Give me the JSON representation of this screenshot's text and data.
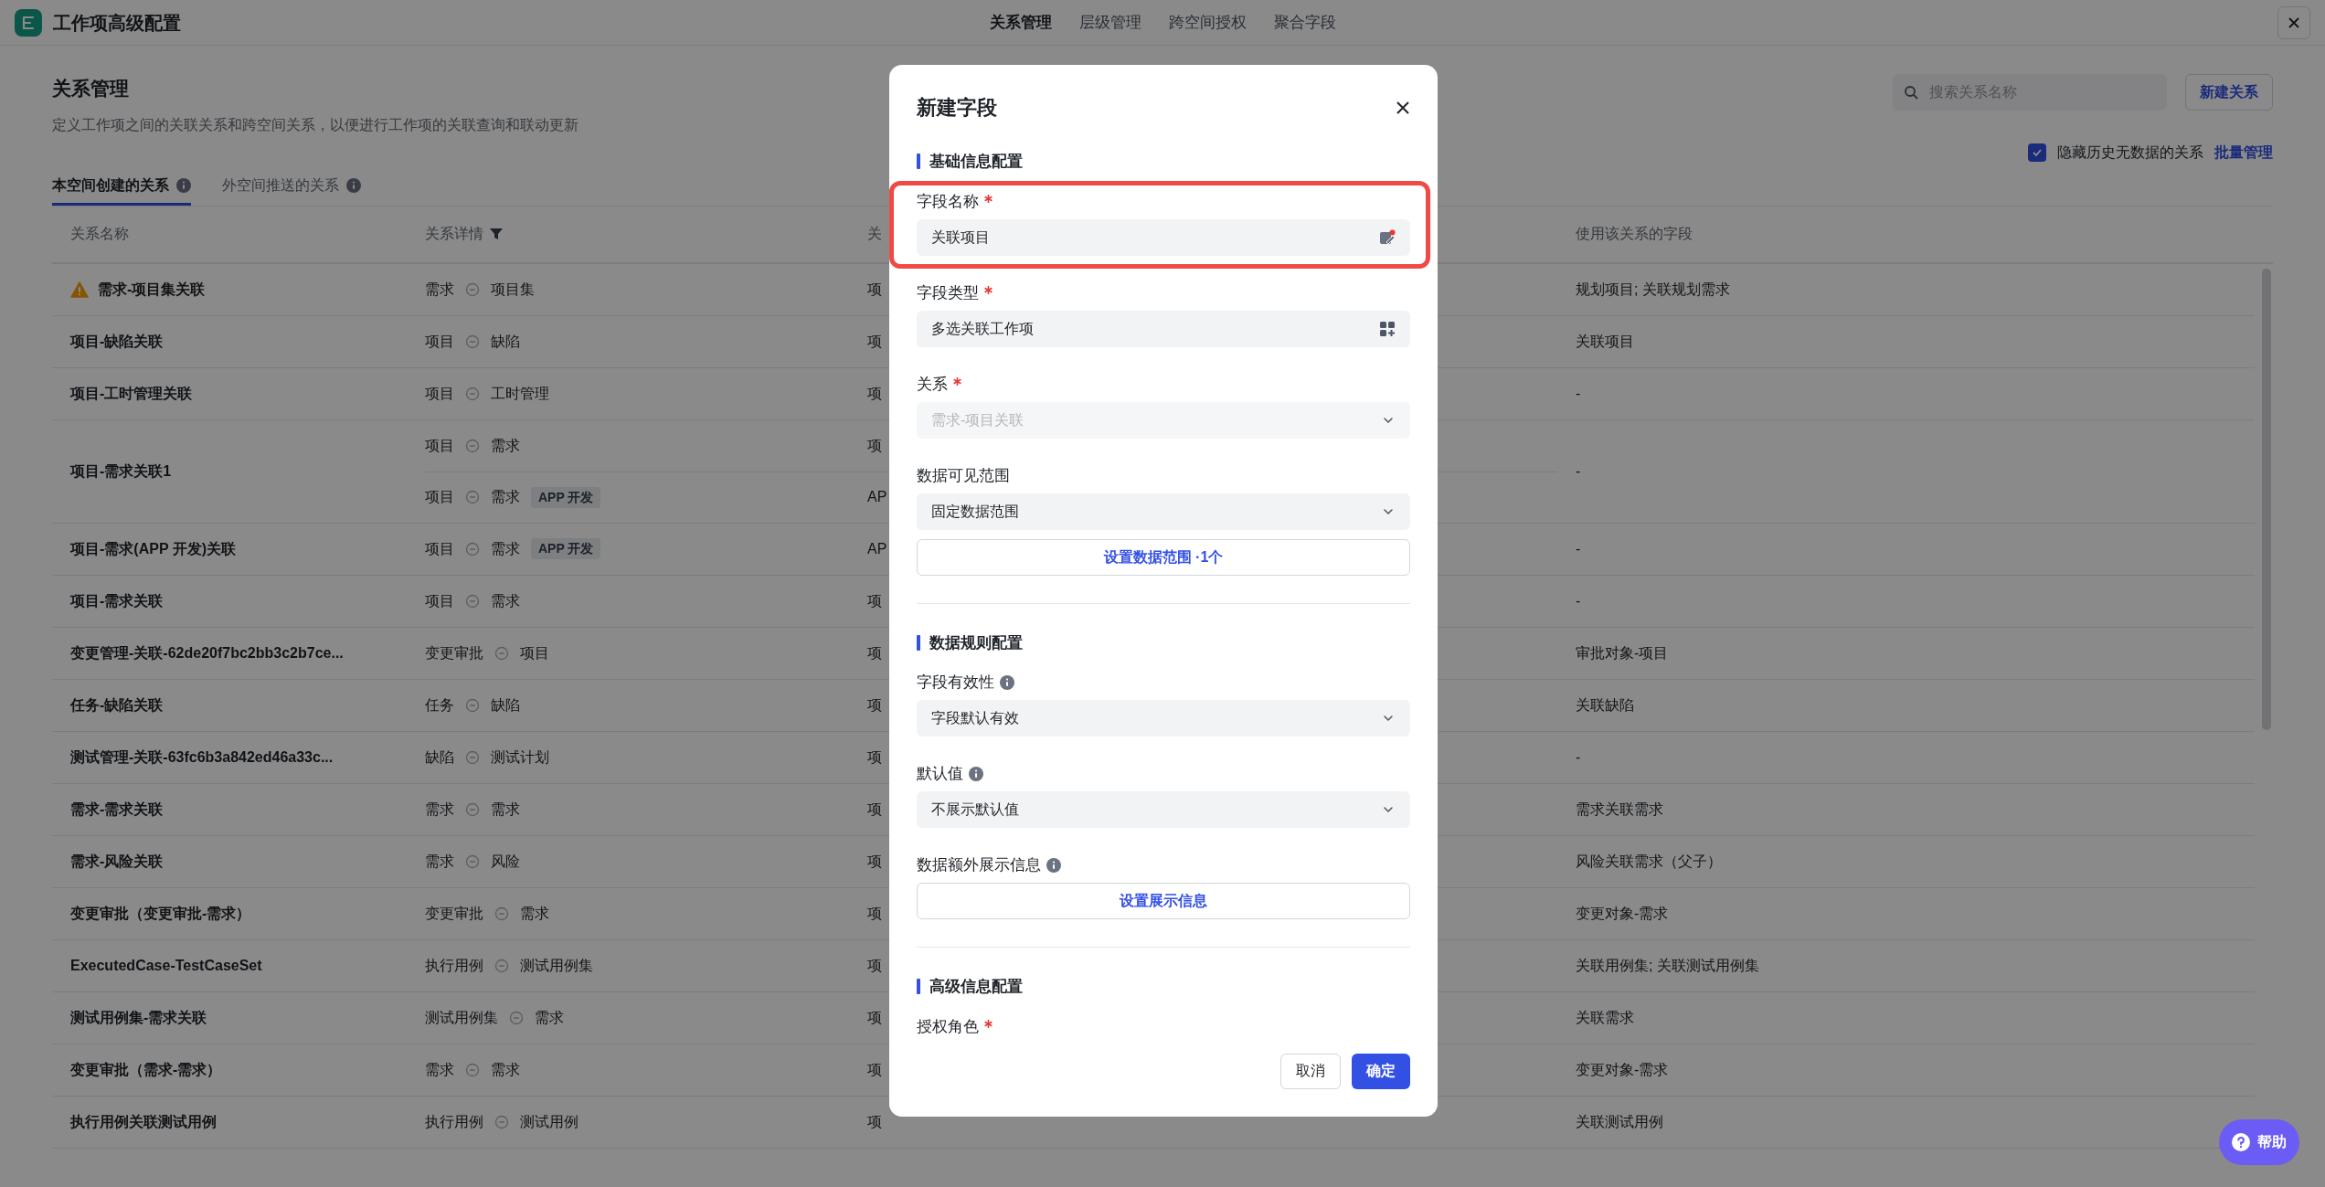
{
  "app": {
    "title": "工作项高级配置"
  },
  "nav": [
    {
      "label": "关系管理",
      "selected": true
    },
    {
      "label": "层级管理",
      "selected": false
    },
    {
      "label": "跨空间授权",
      "selected": false
    },
    {
      "label": "聚合字段",
      "selected": false
    }
  ],
  "page": {
    "title": "关系管理",
    "description": "定义工作项之间的关联关系和跨空间关系，以便进行工作项的关联查询和联动更新",
    "search": {
      "placeholder": "搜索关系名称"
    },
    "new_button": "新建关系",
    "hide_empty": {
      "label": "隐藏历史无数据的关系",
      "checked": true
    },
    "batch_link": "批量管理"
  },
  "tabs": [
    {
      "label": "本空间创建的关系",
      "selected": true
    },
    {
      "label": "外空间推送的关系",
      "selected": false
    }
  ],
  "table": {
    "columns": [
      "关系名称",
      "关系详情",
      "关",
      "使用该关系的字段"
    ],
    "rows": [
      {
        "name": "需求-项目集关联",
        "warning": true,
        "details": [
          {
            "from": "需求",
            "to": "项目集",
            "column_3": "项"
          }
        ],
        "fields": "规划项目; 关联规划需求"
      },
      {
        "name": "项目-缺陷关联",
        "warning": false,
        "details": [
          {
            "from": "项目",
            "to": "缺陷",
            "column_3": "项"
          }
        ],
        "fields": "关联项目"
      },
      {
        "name": "项目-工时管理关联",
        "warning": false,
        "details": [
          {
            "from": "项目",
            "to": "工时管理",
            "column_3": "项"
          }
        ],
        "fields": "-"
      },
      {
        "name": "项目-需求关联1",
        "warning": false,
        "details": [
          {
            "from": "项目",
            "to": "需求",
            "column_3": "项"
          },
          {
            "from": "项目",
            "to": "需求",
            "tag": "APP 开发",
            "column_3": "AP"
          }
        ],
        "fields": "-"
      },
      {
        "name": "项目-需求(APP 开发)关联",
        "warning": false,
        "details": [
          {
            "from": "项目",
            "to": "需求",
            "tag": "APP 开发",
            "column_3": "AP"
          }
        ],
        "fields": "-"
      },
      {
        "name": "项目-需求关联",
        "warning": false,
        "details": [
          {
            "from": "项目",
            "to": "需求",
            "column_3": "项"
          }
        ],
        "fields": "-"
      },
      {
        "name": "变更管理-关联-62de20f7bc2bb3c2b7ce...",
        "warning": false,
        "details": [
          {
            "from": "变更审批",
            "to": "项目",
            "column_3": "项"
          }
        ],
        "fields": "审批对象-项目"
      },
      {
        "name": "任务-缺陷关联",
        "warning": false,
        "details": [
          {
            "from": "任务",
            "to": "缺陷",
            "column_3": "项"
          }
        ],
        "fields": "关联缺陷"
      },
      {
        "name": "测试管理-关联-63fc6b3a842ed46a33c...",
        "warning": false,
        "details": [
          {
            "from": "缺陷",
            "to": "测试计划",
            "column_3": "项"
          }
        ],
        "fields": "-"
      },
      {
        "name": "需求-需求关联",
        "warning": false,
        "details": [
          {
            "from": "需求",
            "to": "需求",
            "column_3": "项"
          }
        ],
        "fields": "需求关联需求"
      },
      {
        "name": "需求-风险关联",
        "warning": false,
        "details": [
          {
            "from": "需求",
            "to": "风险",
            "column_3": "项"
          }
        ],
        "fields": "风险关联需求（父子）"
      },
      {
        "name": "变更审批（变更审批-需求）",
        "warning": false,
        "details": [
          {
            "from": "变更审批",
            "to": "需求",
            "column_3": "项"
          }
        ],
        "fields": "变更对象-需求"
      },
      {
        "name": "ExecutedCase-TestCaseSet",
        "warning": false,
        "details": [
          {
            "from": "执行用例",
            "to": "测试用例集",
            "column_3": "项"
          }
        ],
        "fields": "关联用例集; 关联测试用例集"
      },
      {
        "name": "测试用例集-需求关联",
        "warning": false,
        "details": [
          {
            "from": "测试用例集",
            "to": "需求",
            "column_3": "项"
          }
        ],
        "fields": "关联需求"
      },
      {
        "name": "变更审批（需求-需求）",
        "warning": false,
        "details": [
          {
            "from": "需求",
            "to": "需求",
            "column_3": "项"
          }
        ],
        "fields": "变更对象-需求"
      },
      {
        "name": "执行用例关联测试用例",
        "warning": false,
        "details": [
          {
            "from": "执行用例",
            "to": "测试用例",
            "column_3": "项"
          }
        ],
        "fields": "关联测试用例"
      }
    ]
  },
  "dialog": {
    "title": "新建字段",
    "items": [
      {
        "kind": "section",
        "label": "基础信息配置"
      },
      {
        "kind": "field",
        "label": "字段名称",
        "required": true,
        "info": false,
        "highlighted": true,
        "controls": [
          {
            "kind": "text",
            "value": "关联项目",
            "disabled": false
          }
        ]
      },
      {
        "kind": "field",
        "label": "字段类型",
        "required": true,
        "info": false,
        "highlighted": false,
        "controls": [
          {
            "kind": "type-picker",
            "value": "多选关联工作项",
            "disabled": false
          }
        ]
      },
      {
        "kind": "field",
        "label": "关系",
        "required": true,
        "info": false,
        "highlighted": false,
        "controls": [
          {
            "kind": "select",
            "value": "需求-项目关联",
            "disabled": true
          }
        ]
      },
      {
        "kind": "field",
        "label": "数据可见范围",
        "required": false,
        "info": false,
        "highlighted": false,
        "controls": [
          {
            "kind": "select",
            "value": "固定数据范围",
            "disabled": false
          },
          {
            "kind": "button",
            "value": "设置数据范围 ·1个",
            "disabled": false
          }
        ]
      },
      {
        "kind": "divider"
      },
      {
        "kind": "section",
        "label": "数据规则配置"
      },
      {
        "kind": "field",
        "label": "字段有效性",
        "required": false,
        "info": true,
        "highlighted": false,
        "controls": [
          {
            "kind": "select",
            "value": "字段默认有效",
            "disabled": false
          }
        ]
      },
      {
        "kind": "field",
        "label": "默认值",
        "required": false,
        "info": true,
        "highlighted": false,
        "controls": [
          {
            "kind": "select",
            "value": "不展示默认值",
            "disabled": false
          }
        ]
      },
      {
        "kind": "field",
        "label": "数据额外展示信息",
        "required": false,
        "info": true,
        "highlighted": false,
        "controls": [
          {
            "kind": "button",
            "value": "设置展示信息",
            "disabled": false
          }
        ]
      },
      {
        "kind": "divider"
      },
      {
        "kind": "section",
        "label": "高级信息配置"
      },
      {
        "kind": "field",
        "label": "授权角色",
        "required": true,
        "info": false,
        "highlighted": false
      }
    ],
    "cancel": "取消",
    "confirm": "确定"
  },
  "help": {
    "label": "帮助"
  }
}
